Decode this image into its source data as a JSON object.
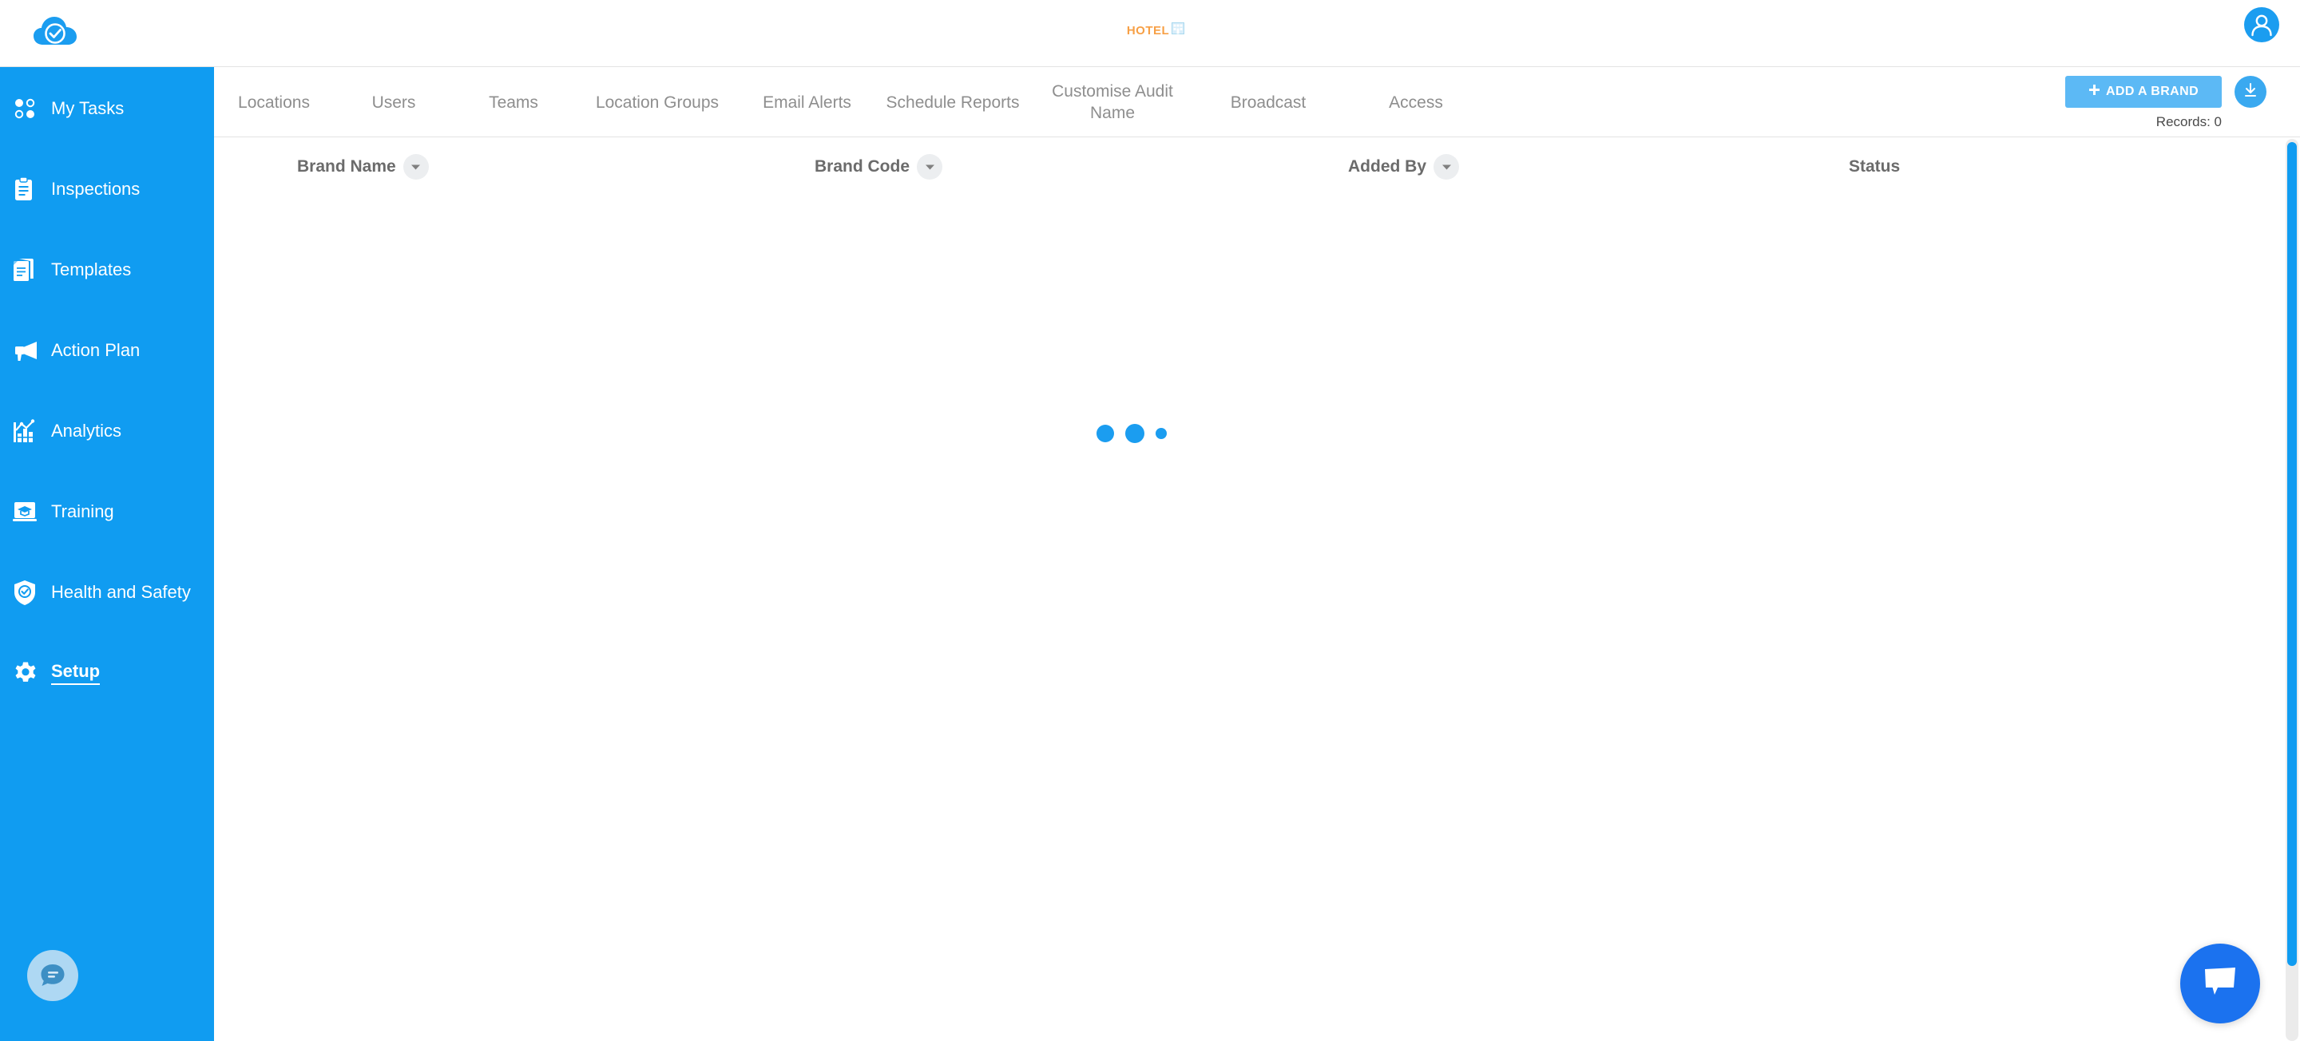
{
  "header": {
    "logo_icon": "cloud-check-logo",
    "center_logo": {
      "word": "HOTEL",
      "ghost_word": "",
      "icon": "hotel-building-icon",
      "word_color": "#f7a046",
      "icon_color": "#a9d8ef"
    },
    "avatar_icon": "user-avatar-icon"
  },
  "sidebar": {
    "background": "#109cf1",
    "items": [
      {
        "label": "My Tasks",
        "icon": "four-dots-icon",
        "active": false
      },
      {
        "label": "Inspections",
        "icon": "clipboard-icon",
        "active": false
      },
      {
        "label": "Templates",
        "icon": "documents-icon",
        "active": false
      },
      {
        "label": "Action Plan",
        "icon": "megaphone-icon",
        "active": false
      },
      {
        "label": "Analytics",
        "icon": "bar-chart-icon",
        "active": false
      },
      {
        "label": "Training",
        "icon": "graduation-laptop-icon",
        "active": false
      },
      {
        "label": "Health and Safety",
        "icon": "shield-check-icon",
        "active": false
      },
      {
        "label": "Setup",
        "icon": "gear-icon",
        "active": true
      }
    ],
    "chat_button_icon": "chat-bubble-lines-icon"
  },
  "tabs": [
    {
      "label": "Locations"
    },
    {
      "label": "Users"
    },
    {
      "label": "Teams"
    },
    {
      "label": "Location Groups"
    },
    {
      "label": "Email Alerts"
    },
    {
      "label": "Schedule Reports"
    },
    {
      "label": "Customise Audit Name"
    },
    {
      "label": "Broadcast"
    },
    {
      "label": "Access"
    }
  ],
  "toolbar": {
    "add_brand_label": "ADD A BRAND",
    "add_brand_icon": "plus-icon",
    "add_brand_color": "#5cb9f5",
    "download_icon": "download-icon",
    "records_label": "Records: 0"
  },
  "table": {
    "columns": [
      {
        "label": "Brand Name",
        "sortable": true
      },
      {
        "label": "Brand Code",
        "sortable": true
      },
      {
        "label": "Added By",
        "sortable": true
      },
      {
        "label": "Status",
        "sortable": false
      }
    ],
    "rows": [],
    "loading": true
  },
  "loader": {
    "icon": "three-dots-loading",
    "color": "#1b9df0"
  },
  "chat_widget": {
    "icon": "speech-bubble-icon",
    "color": "#1b72ef"
  },
  "scrollbar": {
    "thumb_color": "#109cf1",
    "track_color": "#ebebeb"
  }
}
